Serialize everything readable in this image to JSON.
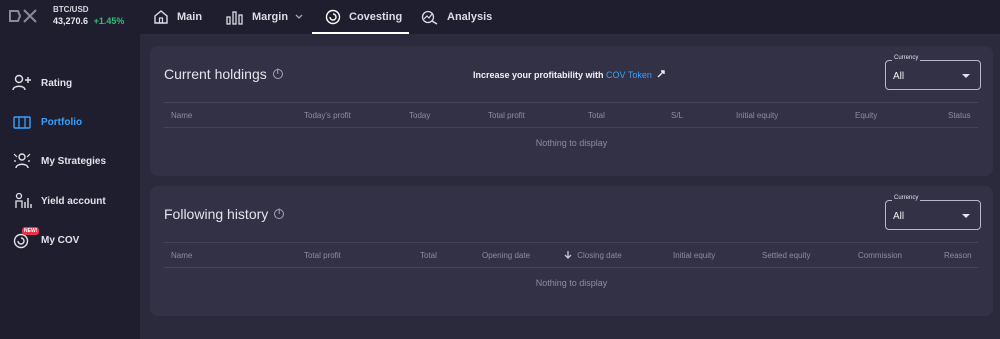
{
  "ticker": {
    "pair": "BTC/USD",
    "price": "43,270.6",
    "change": "+1.45%"
  },
  "nav": {
    "main": "Main",
    "margin": "Margin",
    "covesting": "Covesting",
    "analysis": "Analysis"
  },
  "sidebar": {
    "items": [
      {
        "label": "Rating",
        "icon": "add-user-icon"
      },
      {
        "label": "Portfolio",
        "icon": "portfolio-icon",
        "active": true
      },
      {
        "label": "My Strategies",
        "icon": "strategies-icon"
      },
      {
        "label": "Yield account",
        "icon": "yield-icon"
      },
      {
        "label": "My COV",
        "icon": "cov-icon",
        "badge": "NEW!"
      }
    ]
  },
  "holdings": {
    "title": "Current holdings",
    "promo_text": "Increase your profitability with",
    "promo_link": "COV Token",
    "currency_legend": "Currency",
    "currency_value": "All",
    "columns": [
      "Name",
      "Today's profit",
      "Today",
      "Total profit",
      "Total",
      "S/L",
      "Initial equity",
      "Equity",
      "Status"
    ],
    "empty": "Nothing to display"
  },
  "history": {
    "title": "Following history",
    "currency_legend": "Currency",
    "currency_value": "All",
    "columns": [
      "Name",
      "Total profit",
      "Total",
      "Opening date",
      "Closing date",
      "Initial equity",
      "Settled equity",
      "Commission",
      "Reason"
    ],
    "empty": "Nothing to display"
  },
  "colors": {
    "accent": "#3aa0ff",
    "positive": "#2ec07a",
    "badge": "#e8324a"
  }
}
